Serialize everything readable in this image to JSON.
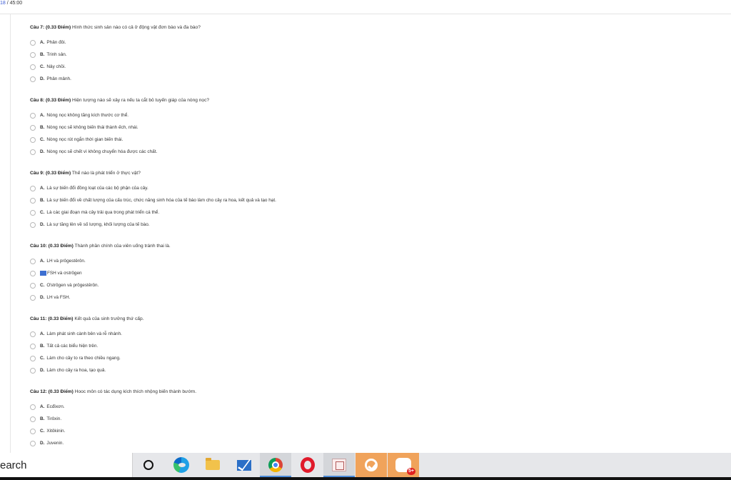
{
  "timer": {
    "current": "18",
    "total": "/ 45:00"
  },
  "questions": [
    {
      "number": "Câu 7:",
      "points": "(0.33 Điểm)",
      "text": "Hình thức sinh sản nào có cả ở động vật đơn bào và đa bào?",
      "options": [
        {
          "letter": "A.",
          "text": "Phân đôi."
        },
        {
          "letter": "B.",
          "text": "Trinh sản."
        },
        {
          "letter": "C.",
          "text": "Nảy chồi."
        },
        {
          "letter": "D.",
          "text": "Phân mảnh."
        }
      ]
    },
    {
      "number": "Câu 8:",
      "points": "(0.33 Điểm)",
      "text": "Hiện tượng nào sẽ xảy ra nếu ta cắt bỏ tuyến giáp của nòng nọc?",
      "options": [
        {
          "letter": "A.",
          "text": "Nòng nọc không tăng kích thước cơ thể."
        },
        {
          "letter": "B.",
          "text": "Nòng nọc sẽ không biến thái thành ếch, nhái."
        },
        {
          "letter": "C.",
          "text": "Nòng nọc rút ngắn thời gian biến thái."
        },
        {
          "letter": "D.",
          "text": "Nòng nọc sẽ chết vì không chuyển hóa được các chất."
        }
      ]
    },
    {
      "number": "Câu 9:",
      "points": "(0.33 Điểm)",
      "text": "Thế nào là phát triển ở thực vật?",
      "options": [
        {
          "letter": "A.",
          "text": "Là sự biến đổi đồng loạt của các bộ phận của cây."
        },
        {
          "letter": "B.",
          "text": "Là sự biến đổi về chất lượng của cấu trúc, chức năng sinh hóa của tế bào làm cho cây ra hoa, kết quả và tạo hạt."
        },
        {
          "letter": "C.",
          "text": "Là các giai đoạn mà cây trải qua trong phát triển cá thể."
        },
        {
          "letter": "D.",
          "text": "Là sự tăng lên về số lượng, khối lượng của tế bào."
        }
      ]
    },
    {
      "number": "Câu 10:",
      "points": "(0.33 Điểm)",
      "text": "Thành phần chính của viên uống tránh thai là.",
      "options": [
        {
          "letter": "A.",
          "text": "LH và prôgestêrôn."
        },
        {
          "letter": "",
          "text": "FSH và ơstrôgen",
          "highlighted": true
        },
        {
          "letter": "C.",
          "text": "Ơstrôgen và prôgestêrôn."
        },
        {
          "letter": "D.",
          "text": "LH và FSH."
        }
      ]
    },
    {
      "number": "Câu 11:",
      "points": "(0.33 Điểm)",
      "text": "Kết quả của sinh trưởng thứ cấp.",
      "options": [
        {
          "letter": "A.",
          "text": "Làm phát sinh cành bên và rễ nhánh."
        },
        {
          "letter": "B.",
          "text": "Tất cả các biểu hiện trên."
        },
        {
          "letter": "C.",
          "text": "Làm cho cây to ra theo chiều ngang."
        },
        {
          "letter": "D.",
          "text": "Làm cho cây ra hoa, tạo quả."
        }
      ]
    },
    {
      "number": "Câu 12:",
      "points": "(0.33 Điểm)",
      "text": "Hooc môn có tác dụng kích thích nhộng biến thành bướm.",
      "options": [
        {
          "letter": "A.",
          "text": "Ecđixơn."
        },
        {
          "letter": "B.",
          "text": "Tirôxin."
        },
        {
          "letter": "C.",
          "text": "Xitôkinin."
        },
        {
          "letter": "D.",
          "text": "Juvenin."
        }
      ]
    }
  ],
  "taskbar": {
    "search_label": "earch",
    "apps": [
      {
        "name": "cortana",
        "icon": "circle-icon"
      },
      {
        "name": "edge",
        "icon": "edge-icon"
      },
      {
        "name": "file-explorer",
        "icon": "folder-icon"
      },
      {
        "name": "mail",
        "icon": "mail-icon"
      },
      {
        "name": "chrome",
        "icon": "chrome-icon"
      },
      {
        "name": "opera",
        "icon": "opera-icon"
      },
      {
        "name": "app",
        "icon": "app-icon"
      },
      {
        "name": "green-app",
        "icon": "check-icon"
      },
      {
        "name": "zalo",
        "icon": "zalo-icon",
        "badge": "5+"
      }
    ],
    "accent": "#4a8ad8",
    "orange": "#f0a35b"
  }
}
